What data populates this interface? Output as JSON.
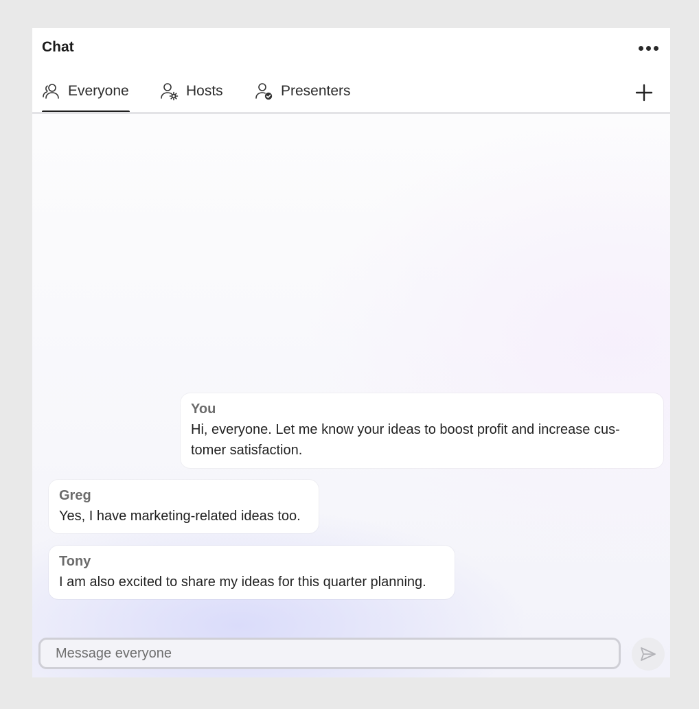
{
  "header": {
    "title": "Chat",
    "more_icon": "more-horizontal-icon",
    "add_icon": "plus-icon"
  },
  "tabs": [
    {
      "label": "Everyone",
      "icon": "people-icon",
      "active": true
    },
    {
      "label": "Hosts",
      "icon": "user-gear-icon",
      "active": false
    },
    {
      "label": "Presenters",
      "icon": "user-check-icon",
      "active": false
    }
  ],
  "messages": [
    {
      "sender": "You",
      "text": "Hi, everyone. Let me know your ideas to boost profit and increase cus- tomer satisfaction."
    },
    {
      "sender": "Greg",
      "text": "Yes, I have marketing-related ideas too."
    },
    {
      "sender": "Tony",
      "text": "I am also excited to share my ideas for this quarter planning."
    }
  ],
  "composer": {
    "placeholder": "Message everyone",
    "value": "",
    "send_icon": "send-icon"
  },
  "colors": {
    "background": "#e9e9e9",
    "panel": "#fbfbfd",
    "bubble": "#ffffff",
    "active_underline": "#1f1f1f"
  }
}
